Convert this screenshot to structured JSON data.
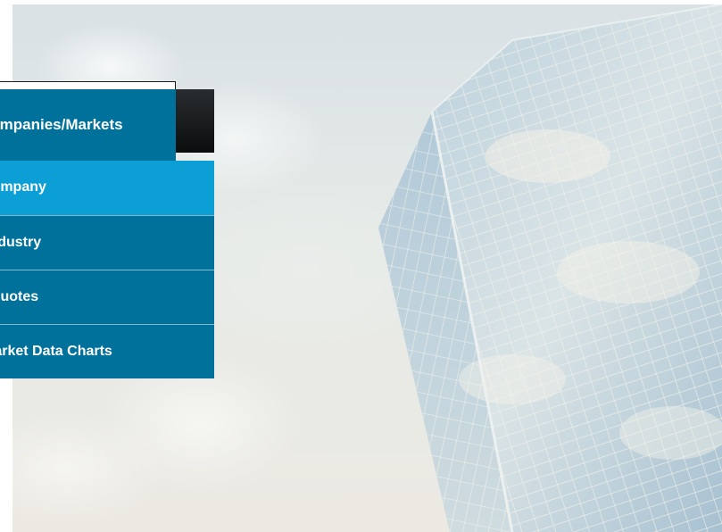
{
  "nav": {
    "header_label": "Companies/Markets",
    "items": [
      {
        "label": "Company",
        "active": true
      },
      {
        "label": "Industry",
        "active": false
      },
      {
        "label": "Quotes",
        "active": false
      },
      {
        "label": "Market Data Charts",
        "active": false
      }
    ]
  },
  "hero": {
    "image_icon": "skyscraper-sky-image"
  },
  "colors": {
    "menu_bg": "#00719a",
    "menu_active": "#0c9fd6",
    "menu_text": "#ffffff",
    "dark_strip": "#0b0c0d"
  }
}
